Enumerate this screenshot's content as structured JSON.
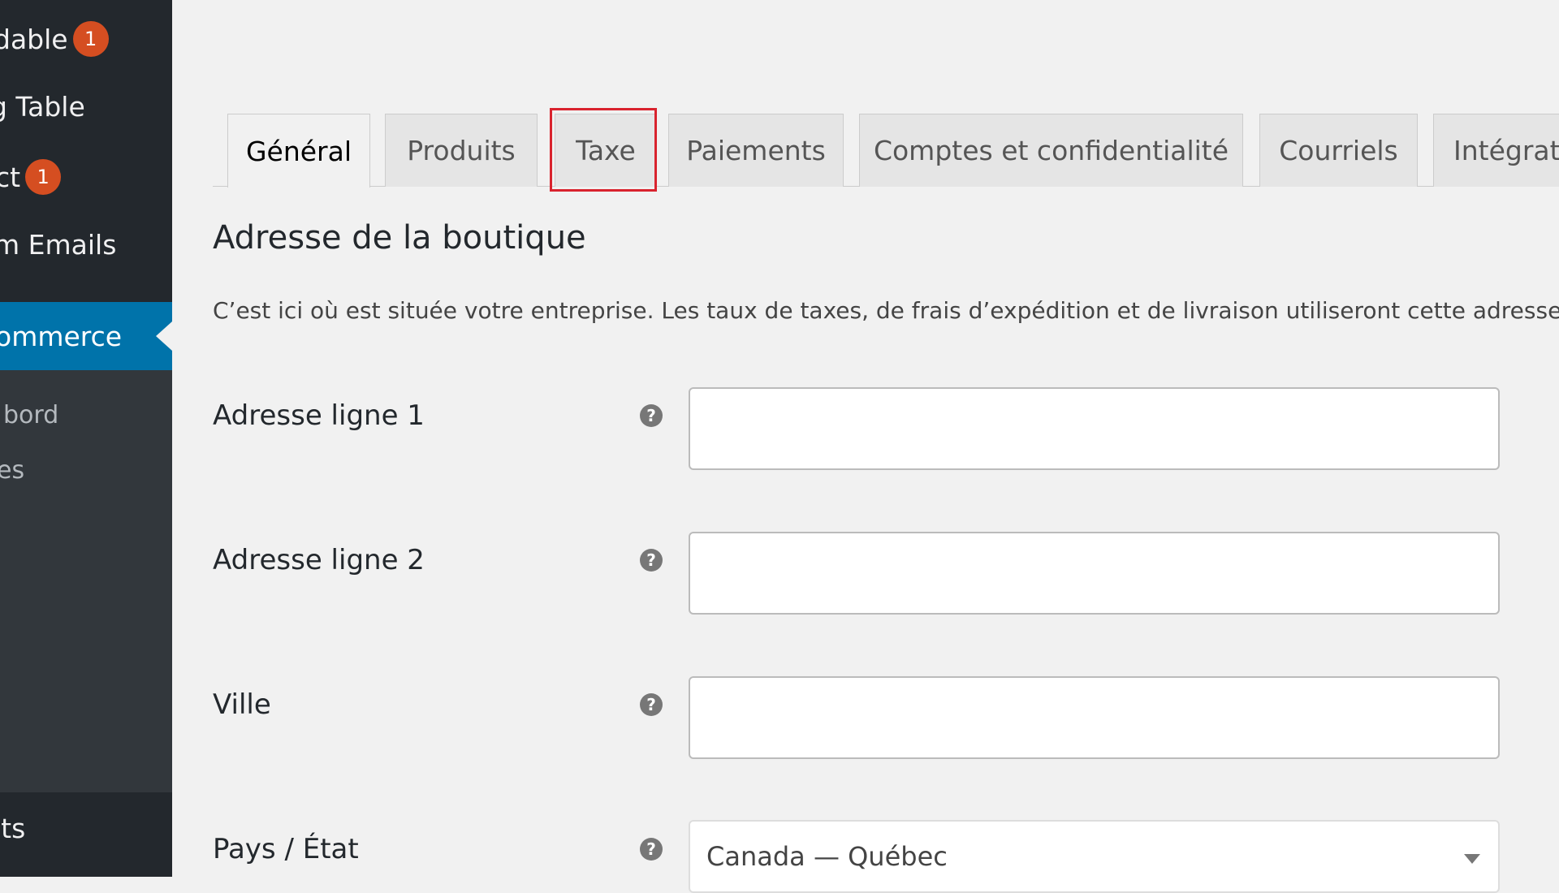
{
  "sidebar": {
    "items": [
      {
        "label": "dable",
        "badge": "1"
      },
      {
        "label": "g Table"
      },
      {
        "label": "ct",
        "badge": "1"
      },
      {
        "label": "m Emails"
      }
    ],
    "active": {
      "label": "ommerce"
    },
    "submenu": [
      {
        "label": "bord"
      },
      {
        "label": "es"
      }
    ],
    "bottom": {
      "label": "its"
    }
  },
  "tabs": [
    {
      "label": "Général",
      "active": true
    },
    {
      "label": "Produits"
    },
    {
      "label": "Taxe"
    },
    {
      "label": "Paiements"
    },
    {
      "label": "Comptes et confidentialité"
    },
    {
      "label": "Courriels"
    },
    {
      "label": "Intégrat"
    }
  ],
  "section": {
    "title": "Adresse de la boutique",
    "description": "C’est ici où est située votre entreprise. Les taux de taxes, de frais d’expédition et de livraison utiliseront cette adresse"
  },
  "fields": [
    {
      "label": "Adresse ligne 1",
      "value": ""
    },
    {
      "label": "Adresse ligne 2",
      "value": ""
    },
    {
      "label": "Ville",
      "value": ""
    },
    {
      "label": "Pays / État",
      "value": "Canada — Québec"
    }
  ],
  "icons": {
    "help": "?"
  },
  "colors": {
    "sidebar_bg": "#23282d",
    "active_menu": "#0073aa",
    "badge": "#d54e21",
    "highlight": "#d9232e"
  }
}
